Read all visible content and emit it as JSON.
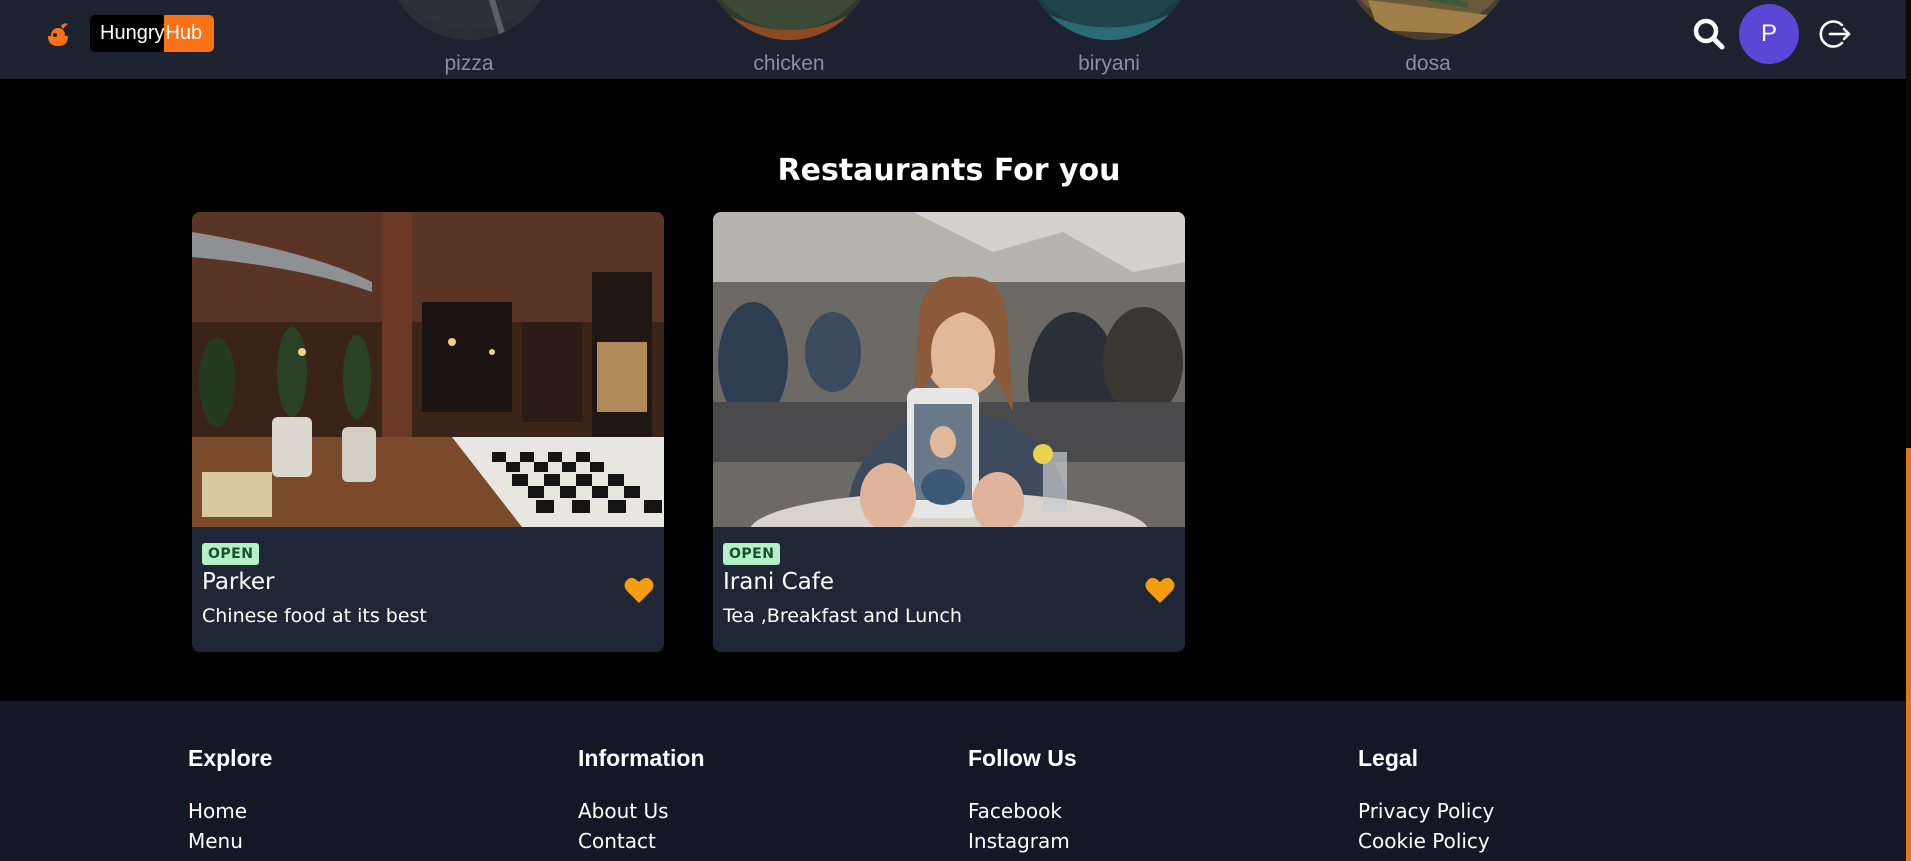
{
  "header": {
    "logo_text_1": "Hungry",
    "logo_text_2": "Hub",
    "brand_color": "#f97316",
    "categories": [
      {
        "label": "pizza"
      },
      {
        "label": "chicken"
      },
      {
        "label": "biryani"
      },
      {
        "label": "dosa"
      }
    ],
    "avatar_initial": "P",
    "avatar_color": "#5b46d6"
  },
  "main": {
    "section_title": "Restaurants For you",
    "restaurants": [
      {
        "status": "OPEN",
        "name": "Parker",
        "description": "Chinese food at its best"
      },
      {
        "status": "OPEN",
        "name": "Irani Cafe",
        "description": "Tea ,Breakfast and Lunch"
      }
    ]
  },
  "footer": {
    "columns": [
      {
        "heading": "Explore",
        "links": [
          "Home",
          "Menu"
        ]
      },
      {
        "heading": "Information",
        "links": [
          "About Us",
          "Contact"
        ]
      },
      {
        "heading": "Follow Us",
        "links": [
          "Facebook",
          "Instagram"
        ]
      },
      {
        "heading": "Legal",
        "links": [
          "Privacy Policy",
          "Cookie Policy"
        ]
      }
    ]
  }
}
